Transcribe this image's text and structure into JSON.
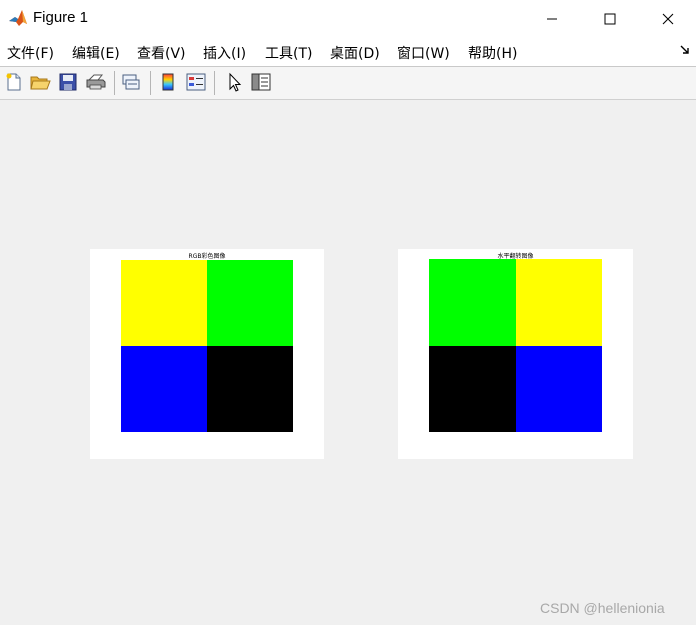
{
  "window": {
    "title": "Figure 1",
    "icon": "matlab-icon",
    "controls": [
      "minimize-icon",
      "maximize-icon",
      "close-icon"
    ]
  },
  "menu": {
    "items": [
      {
        "label": "文件(F)"
      },
      {
        "label": "编辑(E)"
      },
      {
        "label": "查看(V)"
      },
      {
        "label": "插入(I)"
      },
      {
        "label": "工具(T)"
      },
      {
        "label": "桌面(D)"
      },
      {
        "label": "窗口(W)"
      },
      {
        "label": "帮助(H)"
      }
    ],
    "dock_icon": "dock-arrow-icon"
  },
  "toolbar": {
    "tools": [
      "new-figure-icon",
      "open-file-icon",
      "save-icon",
      "print-icon",
      "link-plot-icon",
      "insert-colorbar-icon",
      "insert-legend-icon",
      "pointer-icon",
      "property-inspector-icon"
    ]
  },
  "figures": {
    "left": {
      "title": "RGB彩色图像",
      "quadrants": {
        "top_left": "#ffff00",
        "top_right": "#00ff00",
        "bottom_left": "#0000ff",
        "bottom_right": "#000000"
      }
    },
    "right": {
      "title": "水平翻转图像",
      "quadrants": {
        "top_left": "#00ff00",
        "top_right": "#ffff00",
        "bottom_left": "#000000",
        "bottom_right": "#0000ff"
      }
    }
  },
  "watermark": "CSDN @hellenionia"
}
